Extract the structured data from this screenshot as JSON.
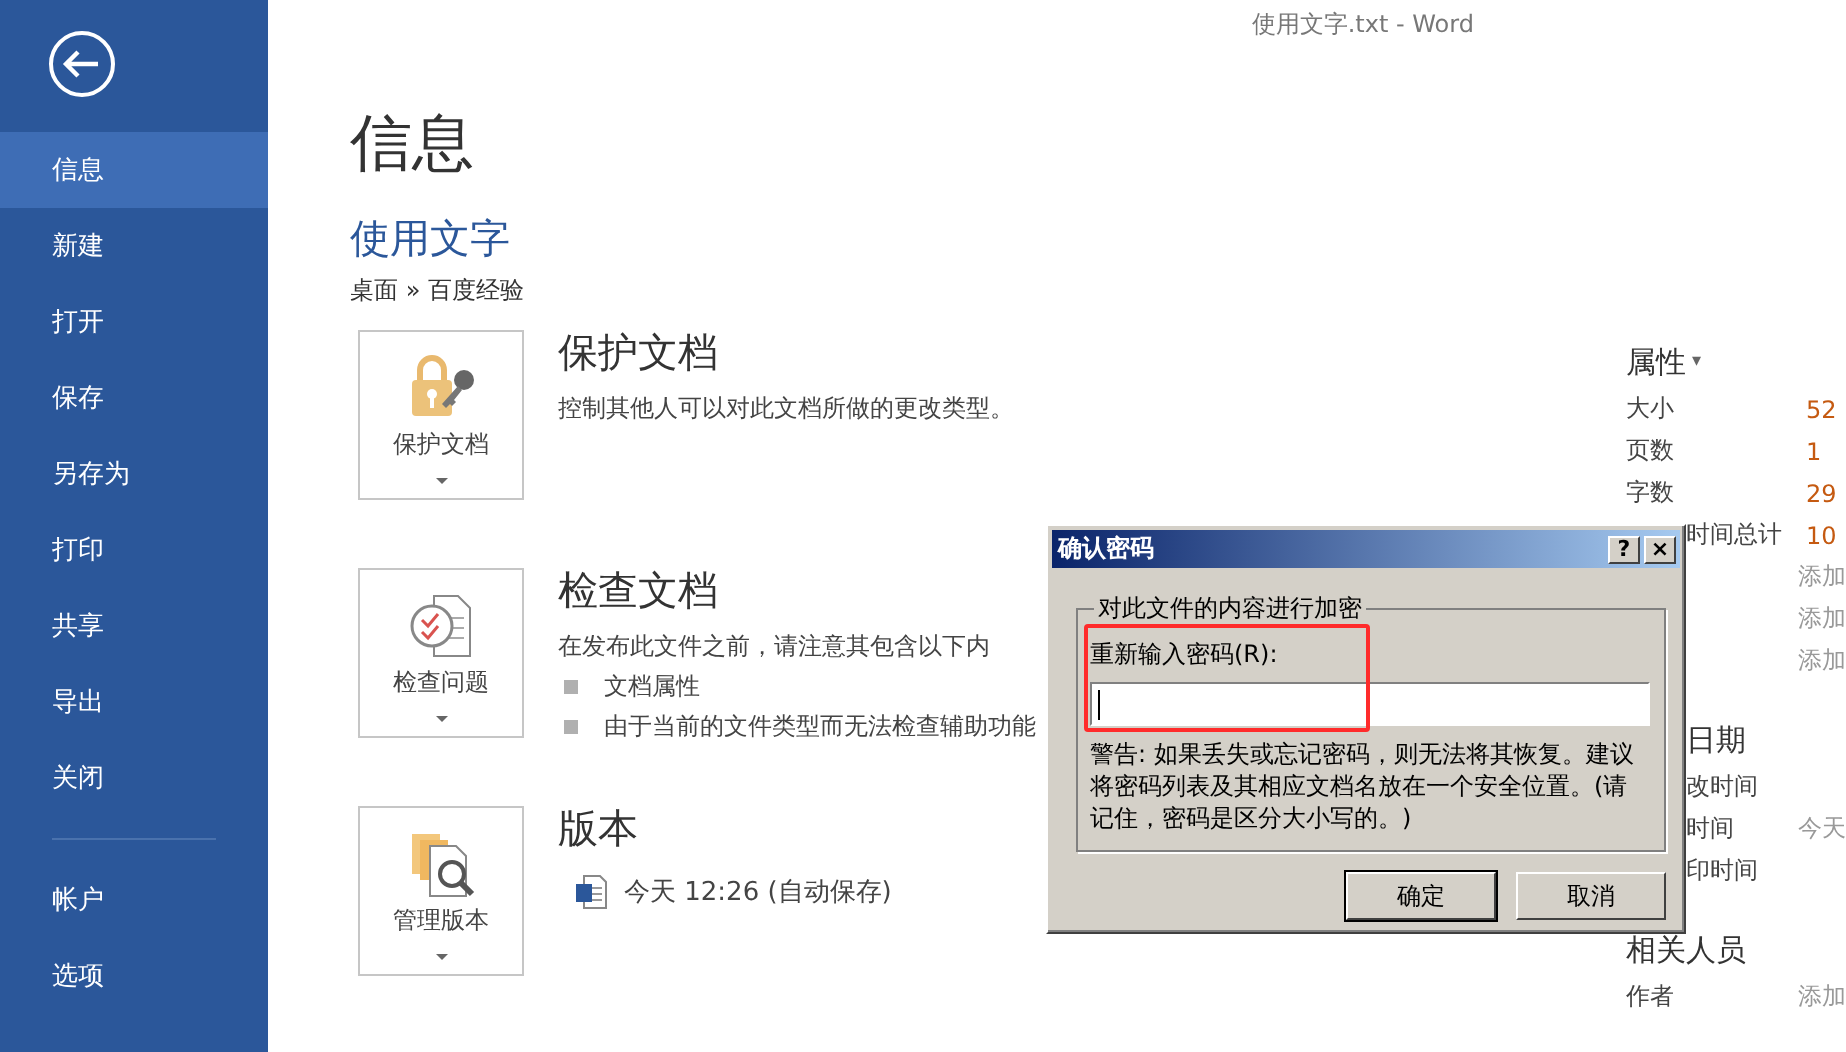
{
  "window": {
    "title": "使用文字.txt - Word"
  },
  "sidebar": {
    "items": [
      {
        "label": "信息",
        "selected": true
      },
      {
        "label": "新建",
        "selected": false
      },
      {
        "label": "打开",
        "selected": false
      },
      {
        "label": "保存",
        "selected": false
      },
      {
        "label": "另存为",
        "selected": false
      },
      {
        "label": "打印",
        "selected": false
      },
      {
        "label": "共享",
        "selected": false
      },
      {
        "label": "导出",
        "selected": false
      },
      {
        "label": "关闭",
        "selected": false
      }
    ],
    "bottom_items": [
      {
        "label": "帐户",
        "selected": false
      },
      {
        "label": "选项",
        "selected": false
      }
    ]
  },
  "page": {
    "heading": "信息",
    "document_title": "使用文字",
    "path": "桌面 » 百度经验"
  },
  "sections": [
    {
      "kind": "protect",
      "button_label": "保护文档",
      "title": "保护文档",
      "description": "控制其他人可以对此文档所做的更改类型。"
    },
    {
      "kind": "inspect",
      "button_label": "检查问题",
      "title": "检查文档",
      "description": "在发布此文件之前，请注意其包含以下内",
      "bullets": [
        "文档属性",
        "由于当前的文件类型而无法检查辅助功能"
      ]
    },
    {
      "kind": "versions",
      "button_label": "管理版本",
      "title": "版本",
      "versions": [
        {
          "text": "今天 12:26 (自动保存)"
        }
      ]
    }
  ],
  "properties": {
    "heading": "属性",
    "caret": "▾",
    "groups": [
      {
        "rows": [
          {
            "label": "大小",
            "value": "52",
            "kind": "value",
            "covered": false
          },
          {
            "label": "页数",
            "value": "1",
            "kind": "value",
            "covered": false
          },
          {
            "label": "字数",
            "value": "29",
            "kind": "value",
            "covered": false
          },
          {
            "label": "时间总计",
            "value": "10",
            "kind": "value",
            "covered": true
          },
          {
            "value": "添加",
            "kind": "hint"
          },
          {
            "value": "添加",
            "kind": "hint"
          },
          {
            "value": "添加",
            "kind": "hint"
          }
        ]
      },
      {
        "heading": "日期",
        "rows": [
          {
            "label": "改时间",
            "covered": true
          },
          {
            "label": "时间",
            "value": "今天",
            "kind": "hint",
            "covered": true
          },
          {
            "label": "印时间",
            "covered": true
          }
        ]
      },
      {
        "heading": "相关人员",
        "rows": [
          {
            "label": "作者",
            "value": "添加",
            "kind": "hint",
            "covered": false
          }
        ]
      }
    ]
  },
  "dialog": {
    "title": "确认密码",
    "help": "?",
    "close": "×",
    "group_label": "对此文件的内容进行加密",
    "field_label": "重新输入密码(R):",
    "warning": "警告: 如果丢失或忘记密码，则无法将其恢复。建议将密码列表及其相应文档名放在一个安全位置。(请记住，密码是区分大小写的。)",
    "buttons": [
      "确定",
      "取消"
    ],
    "highlighted": true
  }
}
